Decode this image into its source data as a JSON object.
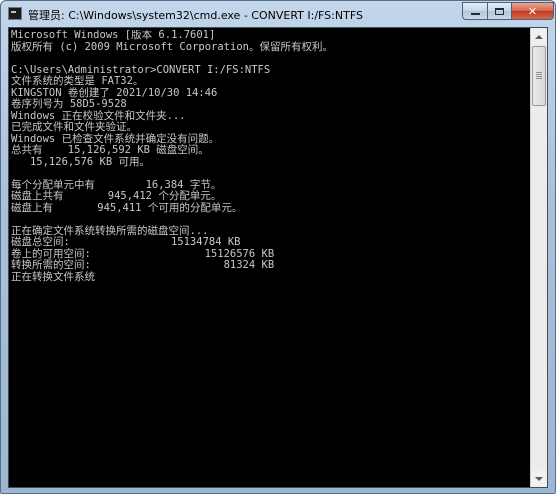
{
  "window": {
    "title": "管理员: C:\\Windows\\system32\\cmd.exe - CONVERT I:/FS:NTFS",
    "icon": "cmd-icon",
    "controls": {
      "minimize_icon": "minimize-icon",
      "maximize_icon": "maximize-icon",
      "close_label": "✕"
    }
  },
  "console": {
    "lines": [
      "Microsoft Windows [版本 6.1.7601]",
      "版权所有 (c) 2009 Microsoft Corporation。保留所有权利。",
      "",
      "C:\\Users\\Administrator>CONVERT I:/FS:NTFS",
      "文件系统的类型是 FAT32。",
      "KINGSTON 卷创建了 2021/10/30 14:46",
      "卷序列号为 58D5-9528",
      "Windows 正在校验文件和文件夹...",
      "已完成文件和文件夹验证。",
      "Windows 已检查文件系统并确定没有问题。",
      "总共有    15,126,592 KB 磁盘空间。",
      "   15,126,576 KB 可用。",
      "",
      "每个分配单元中有        16,384 字节。",
      "磁盘上共有       945,412 个分配单元。",
      "磁盘上有       945,411 个可用的分配单元。",
      "",
      "正在确定文件系统转换所需的磁盘空间...",
      "磁盘总空间:                15134784 KB",
      "卷上的可用空间:                  15126576 KB",
      "转换所需的空间:                     81324 KB",
      "正在转换文件系统"
    ]
  }
}
